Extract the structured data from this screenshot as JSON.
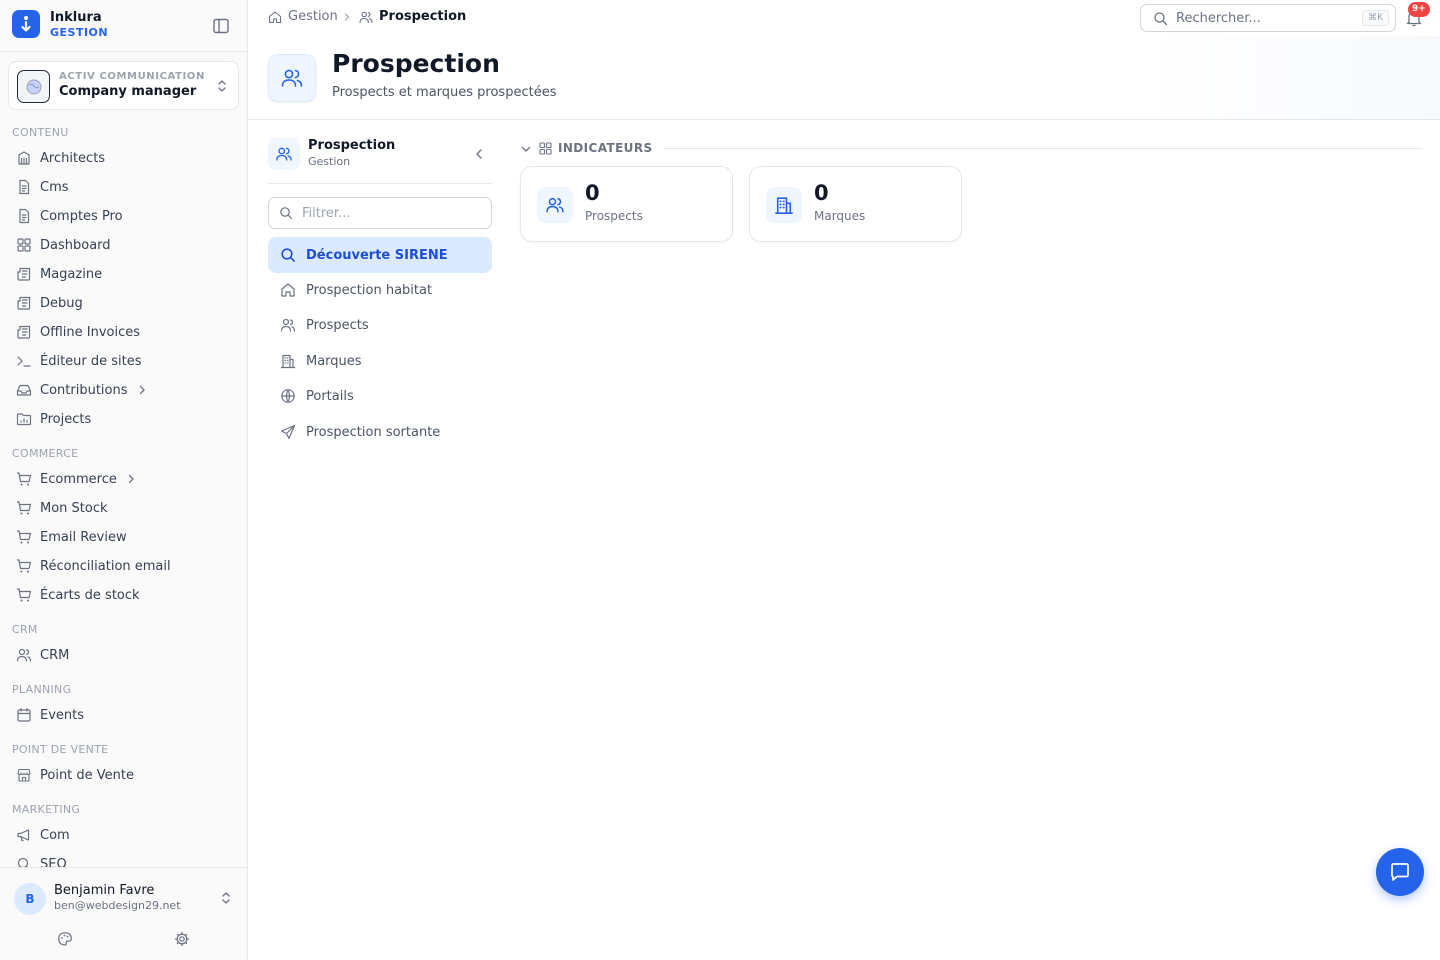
{
  "brand": {
    "name": "Inklura",
    "subtitle": "GESTION"
  },
  "company": {
    "org": "ACTIV COMMUNICATION",
    "role": "Company manager"
  },
  "sidebar": {
    "sections": [
      {
        "label": "CONTENU",
        "items": [
          {
            "label": "Architects",
            "icon": "library-icon"
          },
          {
            "label": "Cms",
            "icon": "document-icon"
          },
          {
            "label": "Comptes Pro",
            "icon": "document-icon"
          },
          {
            "label": "Dashboard",
            "icon": "grid-icon"
          },
          {
            "label": "Magazine",
            "icon": "newspaper-icon"
          },
          {
            "label": "Debug",
            "icon": "newspaper-icon"
          },
          {
            "label": "Offline Invoices",
            "icon": "newspaper-icon"
          },
          {
            "label": "Éditeur de sites",
            "icon": "terminal-icon"
          },
          {
            "label": "Contributions",
            "icon": "inbox-icon",
            "has_children": true
          },
          {
            "label": "Projects",
            "icon": "folder-chart-icon"
          }
        ]
      },
      {
        "label": "COMMERCE",
        "items": [
          {
            "label": "Ecommerce",
            "icon": "cart-icon",
            "has_children": true
          },
          {
            "label": "Mon Stock",
            "icon": "cart-icon"
          },
          {
            "label": "Email Review",
            "icon": "cart-icon"
          },
          {
            "label": "Réconciliation email",
            "icon": "cart-icon"
          },
          {
            "label": "Écarts de stock",
            "icon": "cart-icon"
          }
        ]
      },
      {
        "label": "CRM",
        "items": [
          {
            "label": "CRM",
            "icon": "users-icon"
          }
        ]
      },
      {
        "label": "PLANNING",
        "items": [
          {
            "label": "Events",
            "icon": "calendar-icon"
          }
        ]
      },
      {
        "label": "POINT DE VENTE",
        "items": [
          {
            "label": "Point de Vente",
            "icon": "store-icon"
          }
        ]
      },
      {
        "label": "MARKETING",
        "items": [
          {
            "label": "Com",
            "icon": "megaphone-icon"
          },
          {
            "label": "SEO",
            "icon": "search-icon"
          }
        ]
      }
    ]
  },
  "user": {
    "initial": "B",
    "name": "Benjamin Favre",
    "email": "ben@webdesign29.net"
  },
  "breadcrumb": {
    "parent": "Gestion",
    "current": "Prospection"
  },
  "search": {
    "placeholder": "Rechercher...",
    "shortcut": "⌘K"
  },
  "notifications": {
    "badge": "9+"
  },
  "page": {
    "title": "Prospection",
    "subtitle": "Prospects et marques prospectées"
  },
  "subnav": {
    "title": "Prospection",
    "subtitle": "Gestion",
    "filter_placeholder": "Filtrer...",
    "items": [
      {
        "label": "Découverte SIRENE",
        "icon": "search-icon",
        "active": true
      },
      {
        "label": "Prospection habitat",
        "icon": "home-icon"
      },
      {
        "label": "Prospects",
        "icon": "users-icon"
      },
      {
        "label": "Marques",
        "icon": "building-icon"
      },
      {
        "label": "Portails",
        "icon": "globe-icon"
      },
      {
        "label": "Prospection sortante",
        "icon": "send-icon"
      }
    ]
  },
  "indicators": {
    "label": "INDICATEURS",
    "cards": [
      {
        "value": "0",
        "label": "Prospects",
        "icon": "users-icon"
      },
      {
        "value": "0",
        "label": "Marques",
        "icon": "building-icon"
      }
    ]
  },
  "colors": {
    "accent": "#2563eb",
    "badge": "#ef4444",
    "active_bg": "#dbeafe"
  }
}
